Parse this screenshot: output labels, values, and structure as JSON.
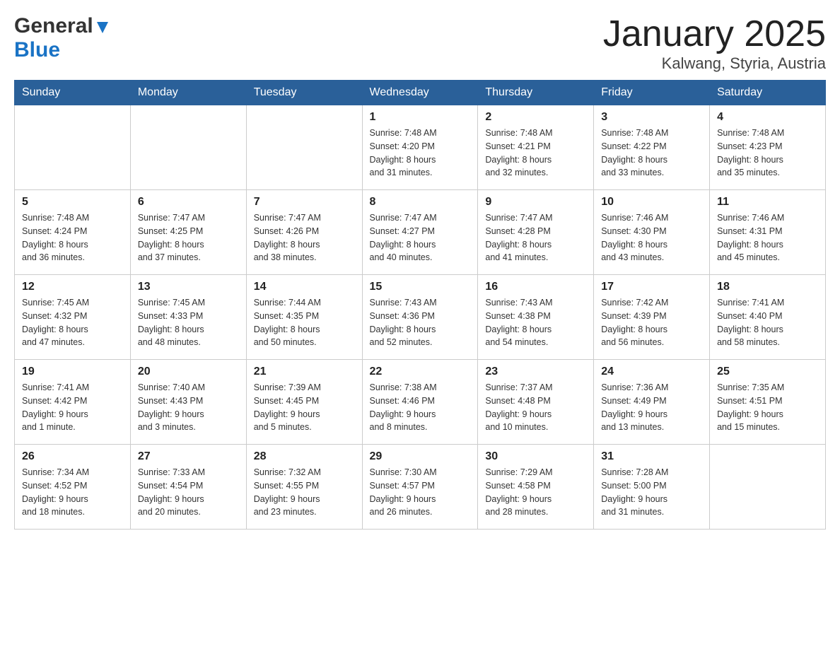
{
  "header": {
    "logo_general": "General",
    "logo_blue": "Blue",
    "title": "January 2025",
    "subtitle": "Kalwang, Styria, Austria"
  },
  "weekdays": [
    "Sunday",
    "Monday",
    "Tuesday",
    "Wednesday",
    "Thursday",
    "Friday",
    "Saturday"
  ],
  "weeks": [
    [
      {
        "day": "",
        "info": ""
      },
      {
        "day": "",
        "info": ""
      },
      {
        "day": "",
        "info": ""
      },
      {
        "day": "1",
        "info": "Sunrise: 7:48 AM\nSunset: 4:20 PM\nDaylight: 8 hours\nand 31 minutes."
      },
      {
        "day": "2",
        "info": "Sunrise: 7:48 AM\nSunset: 4:21 PM\nDaylight: 8 hours\nand 32 minutes."
      },
      {
        "day": "3",
        "info": "Sunrise: 7:48 AM\nSunset: 4:22 PM\nDaylight: 8 hours\nand 33 minutes."
      },
      {
        "day": "4",
        "info": "Sunrise: 7:48 AM\nSunset: 4:23 PM\nDaylight: 8 hours\nand 35 minutes."
      }
    ],
    [
      {
        "day": "5",
        "info": "Sunrise: 7:48 AM\nSunset: 4:24 PM\nDaylight: 8 hours\nand 36 minutes."
      },
      {
        "day": "6",
        "info": "Sunrise: 7:47 AM\nSunset: 4:25 PM\nDaylight: 8 hours\nand 37 minutes."
      },
      {
        "day": "7",
        "info": "Sunrise: 7:47 AM\nSunset: 4:26 PM\nDaylight: 8 hours\nand 38 minutes."
      },
      {
        "day": "8",
        "info": "Sunrise: 7:47 AM\nSunset: 4:27 PM\nDaylight: 8 hours\nand 40 minutes."
      },
      {
        "day": "9",
        "info": "Sunrise: 7:47 AM\nSunset: 4:28 PM\nDaylight: 8 hours\nand 41 minutes."
      },
      {
        "day": "10",
        "info": "Sunrise: 7:46 AM\nSunset: 4:30 PM\nDaylight: 8 hours\nand 43 minutes."
      },
      {
        "day": "11",
        "info": "Sunrise: 7:46 AM\nSunset: 4:31 PM\nDaylight: 8 hours\nand 45 minutes."
      }
    ],
    [
      {
        "day": "12",
        "info": "Sunrise: 7:45 AM\nSunset: 4:32 PM\nDaylight: 8 hours\nand 47 minutes."
      },
      {
        "day": "13",
        "info": "Sunrise: 7:45 AM\nSunset: 4:33 PM\nDaylight: 8 hours\nand 48 minutes."
      },
      {
        "day": "14",
        "info": "Sunrise: 7:44 AM\nSunset: 4:35 PM\nDaylight: 8 hours\nand 50 minutes."
      },
      {
        "day": "15",
        "info": "Sunrise: 7:43 AM\nSunset: 4:36 PM\nDaylight: 8 hours\nand 52 minutes."
      },
      {
        "day": "16",
        "info": "Sunrise: 7:43 AM\nSunset: 4:38 PM\nDaylight: 8 hours\nand 54 minutes."
      },
      {
        "day": "17",
        "info": "Sunrise: 7:42 AM\nSunset: 4:39 PM\nDaylight: 8 hours\nand 56 minutes."
      },
      {
        "day": "18",
        "info": "Sunrise: 7:41 AM\nSunset: 4:40 PM\nDaylight: 8 hours\nand 58 minutes."
      }
    ],
    [
      {
        "day": "19",
        "info": "Sunrise: 7:41 AM\nSunset: 4:42 PM\nDaylight: 9 hours\nand 1 minute."
      },
      {
        "day": "20",
        "info": "Sunrise: 7:40 AM\nSunset: 4:43 PM\nDaylight: 9 hours\nand 3 minutes."
      },
      {
        "day": "21",
        "info": "Sunrise: 7:39 AM\nSunset: 4:45 PM\nDaylight: 9 hours\nand 5 minutes."
      },
      {
        "day": "22",
        "info": "Sunrise: 7:38 AM\nSunset: 4:46 PM\nDaylight: 9 hours\nand 8 minutes."
      },
      {
        "day": "23",
        "info": "Sunrise: 7:37 AM\nSunset: 4:48 PM\nDaylight: 9 hours\nand 10 minutes."
      },
      {
        "day": "24",
        "info": "Sunrise: 7:36 AM\nSunset: 4:49 PM\nDaylight: 9 hours\nand 13 minutes."
      },
      {
        "day": "25",
        "info": "Sunrise: 7:35 AM\nSunset: 4:51 PM\nDaylight: 9 hours\nand 15 minutes."
      }
    ],
    [
      {
        "day": "26",
        "info": "Sunrise: 7:34 AM\nSunset: 4:52 PM\nDaylight: 9 hours\nand 18 minutes."
      },
      {
        "day": "27",
        "info": "Sunrise: 7:33 AM\nSunset: 4:54 PM\nDaylight: 9 hours\nand 20 minutes."
      },
      {
        "day": "28",
        "info": "Sunrise: 7:32 AM\nSunset: 4:55 PM\nDaylight: 9 hours\nand 23 minutes."
      },
      {
        "day": "29",
        "info": "Sunrise: 7:30 AM\nSunset: 4:57 PM\nDaylight: 9 hours\nand 26 minutes."
      },
      {
        "day": "30",
        "info": "Sunrise: 7:29 AM\nSunset: 4:58 PM\nDaylight: 9 hours\nand 28 minutes."
      },
      {
        "day": "31",
        "info": "Sunrise: 7:28 AM\nSunset: 5:00 PM\nDaylight: 9 hours\nand 31 minutes."
      },
      {
        "day": "",
        "info": ""
      }
    ]
  ]
}
